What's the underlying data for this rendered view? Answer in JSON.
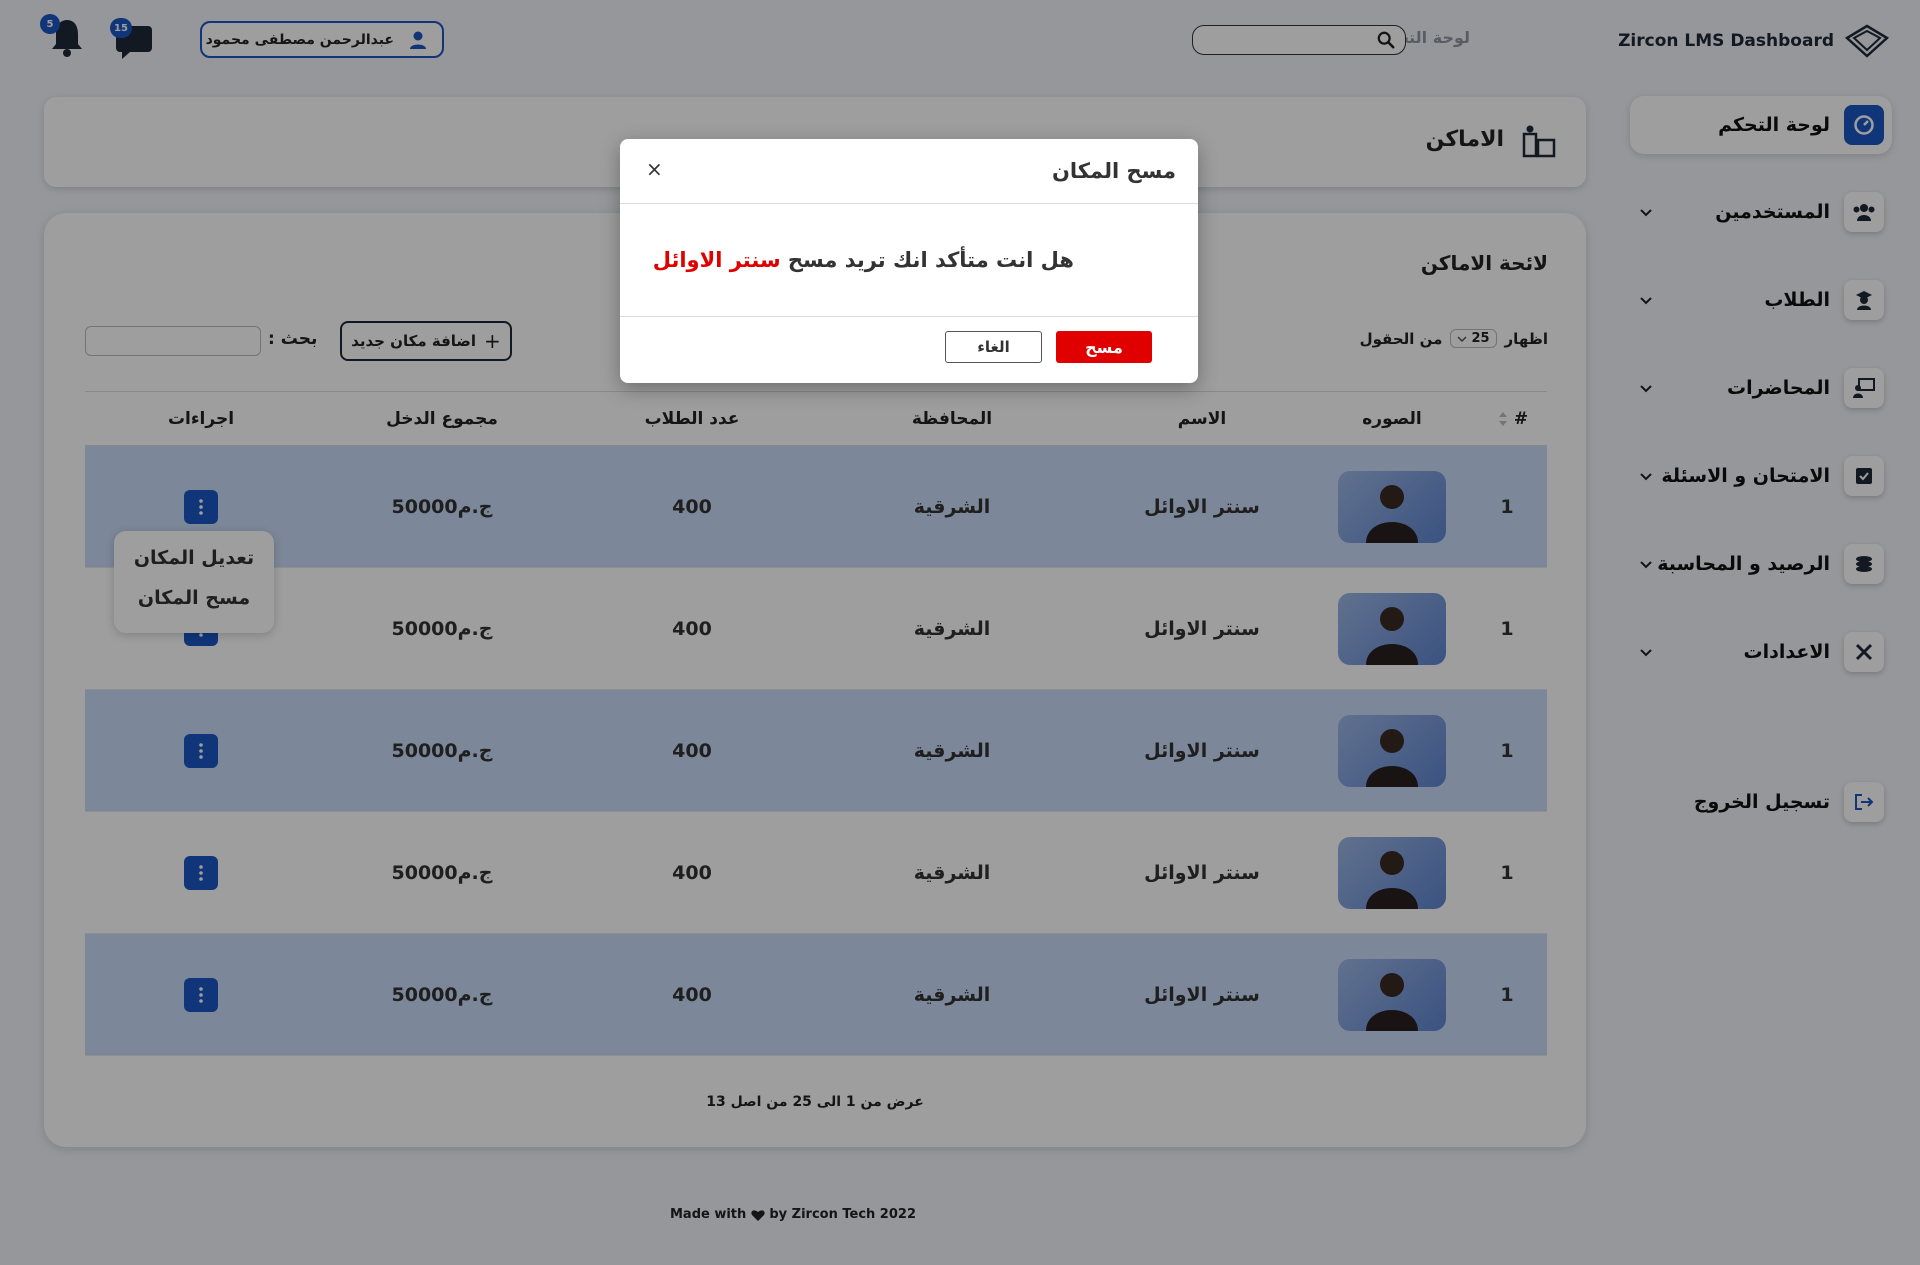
{
  "app": {
    "brand_name": "Zircon LMS Dashboard",
    "top_title": "لوحة التحكم",
    "user_name": "عبدالرحمن مصطفى محمود",
    "messages_badge": "15",
    "notifications_badge": "5"
  },
  "sidebar": {
    "items": [
      {
        "label": "لوحة التحكم",
        "icon": "dashboard-icon",
        "active": true
      },
      {
        "label": "المستخدمين",
        "icon": "users-icon"
      },
      {
        "label": "الطلاب",
        "icon": "student-icon"
      },
      {
        "label": "المحاضرات",
        "icon": "lecture-icon"
      },
      {
        "label": "الامتحان و الاسئلة",
        "icon": "exam-icon"
      },
      {
        "label": "الرصيد و المحاسبة",
        "icon": "coins-icon"
      },
      {
        "label": "الاعدادات",
        "icon": "tools-icon"
      }
    ],
    "logout_label": "تسجيل الخروج"
  },
  "header": {
    "title": "الاماكن"
  },
  "list": {
    "title": "لائحة الاماكن",
    "show_label": "اظهار",
    "show_value": "25",
    "fields_label": "من الحقول",
    "add_button": "اضافة مكان جديد",
    "search_label": "بحث :",
    "columns": [
      "#",
      "الصوره",
      "الاسم",
      "المحافظة",
      "عدد الطلاب",
      "مجموع الدخل",
      "اجراءات"
    ],
    "rows": [
      {
        "num": "1",
        "name": "سنتر الاوائل",
        "gov": "الشرقية",
        "students": "400",
        "income": "50000ج.م"
      },
      {
        "num": "1",
        "name": "سنتر الاوائل",
        "gov": "الشرقية",
        "students": "400",
        "income": "50000ج.م"
      },
      {
        "num": "1",
        "name": "سنتر الاوائل",
        "gov": "الشرقية",
        "students": "400",
        "income": "50000ج.م"
      },
      {
        "num": "1",
        "name": "سنتر الاوائل",
        "gov": "الشرقية",
        "students": "400",
        "income": "50000ج.م"
      },
      {
        "num": "1",
        "name": "سنتر الاوائل",
        "gov": "الشرقية",
        "students": "400",
        "income": "50000ج.م"
      }
    ],
    "dropdown": [
      "تعديل المكان",
      "مسح المكان"
    ],
    "pager_info": "عرض من 1 الى 25 من اصل 13"
  },
  "footer": {
    "made_with": "Made with",
    "by": "by Zircon Tech 2022"
  },
  "modal": {
    "title": "مسح المكان",
    "close": "×",
    "message": "هل انت متأكد انك تريد مسح",
    "highlight": "سنتر الاوائل",
    "delete_label": "مسح",
    "cancel_label": "الغاء"
  },
  "colors": {
    "primary": "#1a56c4",
    "danger": "#e00000",
    "row_shade": "#c9dcf7"
  }
}
